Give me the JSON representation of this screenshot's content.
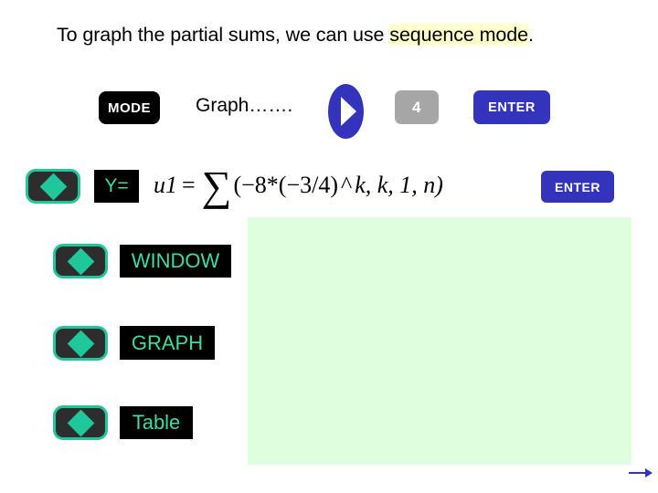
{
  "slide": {
    "title": {
      "lead": "To graph the partial sums, we can use ",
      "highlight": "sequence mode",
      "trail": "."
    },
    "colors": {
      "highlight_background": "#ffffcc",
      "panel_background": "#ddffdd",
      "key_blue": "#3333bb",
      "key_gray": "#a6a6a6",
      "key_black": "#000000",
      "screen_teal": "#3ddba5",
      "diamond_teal": "#1fc79a",
      "arrow_blue": "#3333bb"
    },
    "steps_row": {
      "mode_key": "MODE",
      "graph_label": "Graph…….",
      "cursor_icon": "play-right-icon",
      "four_key": "4",
      "enter_key": "ENTER"
    },
    "entry_row": {
      "diamond_icon": "diamond-key-icon",
      "screen_label": "Y=",
      "formula": {
        "lhs": "u1",
        "equals": "=",
        "sigma": "∑",
        "body_before_exp": "(−8*(−3/4)",
        "caret": "^",
        "exponent": "k",
        "args": ", k, 1, n)",
        "full_text": "u1 = ∑(−8*(−3/4)^k, k, 1, n)"
      },
      "enter_key": "ENTER"
    },
    "menu_rows": [
      {
        "diamond_icon": "diamond-key-icon",
        "label": "WINDOW"
      },
      {
        "diamond_icon": "diamond-key-icon",
        "label": "GRAPH"
      },
      {
        "diamond_icon": "diamond-key-icon",
        "label": "Table"
      }
    ],
    "next_arrow_icon": "arrow-right-icon"
  }
}
